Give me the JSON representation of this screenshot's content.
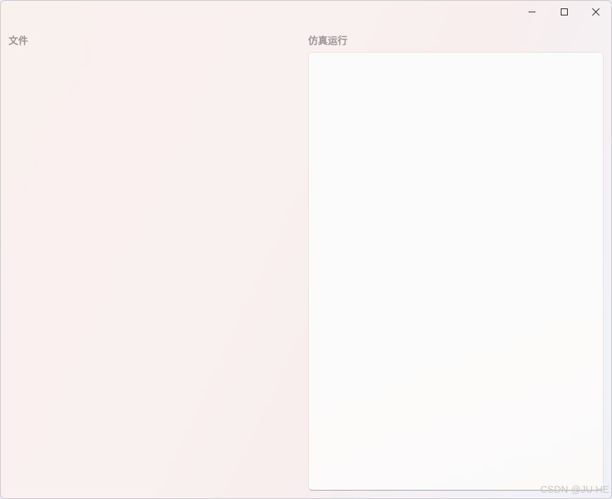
{
  "window": {
    "controls": {
      "minimize_icon": "minimize-icon",
      "maximize_icon": "maximize-icon",
      "close_icon": "close-icon"
    }
  },
  "sections": {
    "files_title": "文件",
    "simulation_title": "仿真运行"
  },
  "watermark": "CSDN @JU HE",
  "colors": {
    "title_text": "#9b9595",
    "panel_bg": "#fcfbfb",
    "window_bg": "#f9f0f0"
  }
}
